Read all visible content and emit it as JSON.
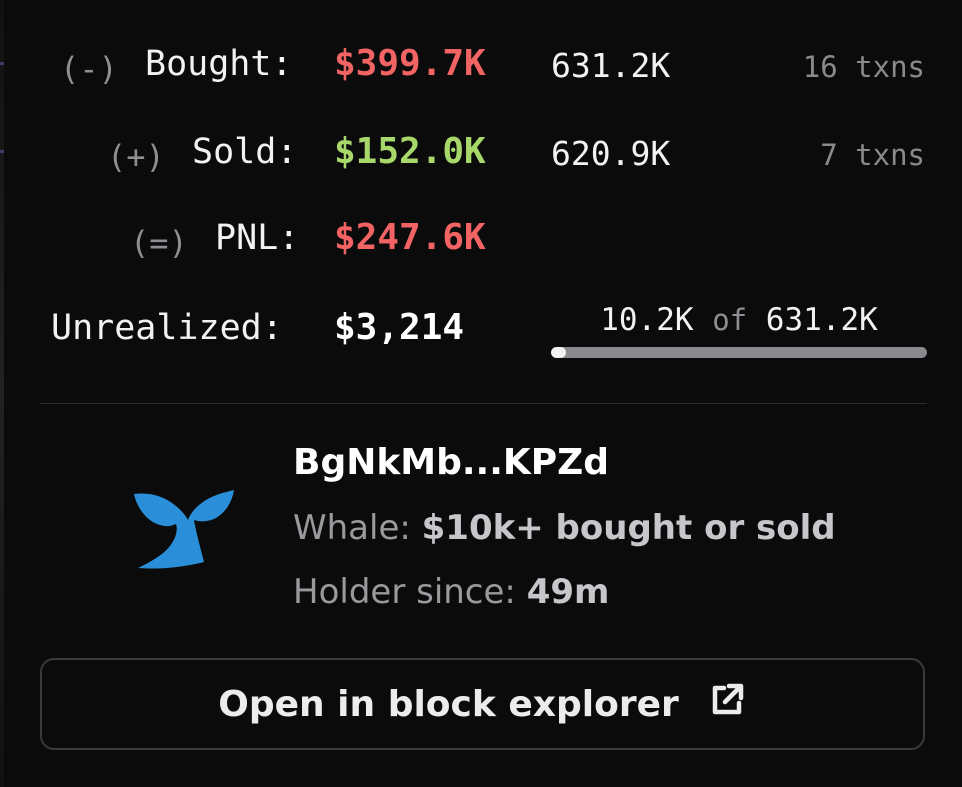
{
  "rows": {
    "bought": {
      "sign": "(-)",
      "label": "Bought:",
      "amount": "$399.7K",
      "tokens": "631.2K",
      "txns": "16 txns"
    },
    "sold": {
      "sign": "(+)",
      "label": "Sold:",
      "amount": "$152.0K",
      "tokens": "620.9K",
      "txns": "7 txns"
    },
    "pnl": {
      "sign": "(=)",
      "label": "PNL:",
      "amount": "$247.6K"
    },
    "unrealized": {
      "label": "Unrealized:",
      "amount": "$3,214"
    }
  },
  "holding": {
    "held": "10.2K",
    "of": "of",
    "total": "631.2K",
    "fraction": 0.0162
  },
  "wallet": {
    "address": "BgNkMb...KPZd",
    "type_label": "Whale:",
    "type_value": "$10k+ bought or sold",
    "since_label": "Holder since:",
    "since_value": "49m",
    "icon": "whale-tail-icon"
  },
  "explorer_button": {
    "label": "Open in block explorer",
    "icon": "external-link-icon"
  },
  "colors": {
    "loss": "#f26363",
    "gain": "#a8d86a",
    "whale": "#2a8fd8"
  }
}
